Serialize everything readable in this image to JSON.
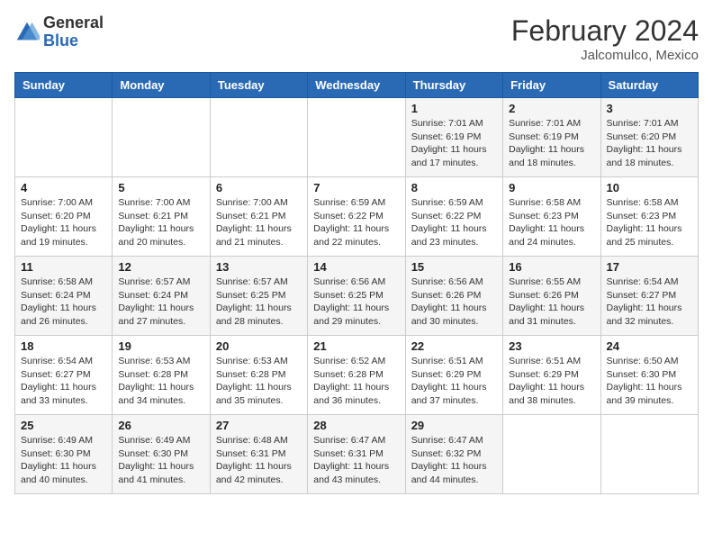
{
  "header": {
    "logo_general": "General",
    "logo_blue": "Blue",
    "month_title": "February 2024",
    "location": "Jalcomulco, Mexico"
  },
  "weekdays": [
    "Sunday",
    "Monday",
    "Tuesday",
    "Wednesday",
    "Thursday",
    "Friday",
    "Saturday"
  ],
  "weeks": [
    [
      {
        "day": "",
        "info": ""
      },
      {
        "day": "",
        "info": ""
      },
      {
        "day": "",
        "info": ""
      },
      {
        "day": "",
        "info": ""
      },
      {
        "day": "1",
        "info": "Sunrise: 7:01 AM\nSunset: 6:19 PM\nDaylight: 11 hours and 17 minutes."
      },
      {
        "day": "2",
        "info": "Sunrise: 7:01 AM\nSunset: 6:19 PM\nDaylight: 11 hours and 18 minutes."
      },
      {
        "day": "3",
        "info": "Sunrise: 7:01 AM\nSunset: 6:20 PM\nDaylight: 11 hours and 18 minutes."
      }
    ],
    [
      {
        "day": "4",
        "info": "Sunrise: 7:00 AM\nSunset: 6:20 PM\nDaylight: 11 hours and 19 minutes."
      },
      {
        "day": "5",
        "info": "Sunrise: 7:00 AM\nSunset: 6:21 PM\nDaylight: 11 hours and 20 minutes."
      },
      {
        "day": "6",
        "info": "Sunrise: 7:00 AM\nSunset: 6:21 PM\nDaylight: 11 hours and 21 minutes."
      },
      {
        "day": "7",
        "info": "Sunrise: 6:59 AM\nSunset: 6:22 PM\nDaylight: 11 hours and 22 minutes."
      },
      {
        "day": "8",
        "info": "Sunrise: 6:59 AM\nSunset: 6:22 PM\nDaylight: 11 hours and 23 minutes."
      },
      {
        "day": "9",
        "info": "Sunrise: 6:58 AM\nSunset: 6:23 PM\nDaylight: 11 hours and 24 minutes."
      },
      {
        "day": "10",
        "info": "Sunrise: 6:58 AM\nSunset: 6:23 PM\nDaylight: 11 hours and 25 minutes."
      }
    ],
    [
      {
        "day": "11",
        "info": "Sunrise: 6:58 AM\nSunset: 6:24 PM\nDaylight: 11 hours and 26 minutes."
      },
      {
        "day": "12",
        "info": "Sunrise: 6:57 AM\nSunset: 6:24 PM\nDaylight: 11 hours and 27 minutes."
      },
      {
        "day": "13",
        "info": "Sunrise: 6:57 AM\nSunset: 6:25 PM\nDaylight: 11 hours and 28 minutes."
      },
      {
        "day": "14",
        "info": "Sunrise: 6:56 AM\nSunset: 6:25 PM\nDaylight: 11 hours and 29 minutes."
      },
      {
        "day": "15",
        "info": "Sunrise: 6:56 AM\nSunset: 6:26 PM\nDaylight: 11 hours and 30 minutes."
      },
      {
        "day": "16",
        "info": "Sunrise: 6:55 AM\nSunset: 6:26 PM\nDaylight: 11 hours and 31 minutes."
      },
      {
        "day": "17",
        "info": "Sunrise: 6:54 AM\nSunset: 6:27 PM\nDaylight: 11 hours and 32 minutes."
      }
    ],
    [
      {
        "day": "18",
        "info": "Sunrise: 6:54 AM\nSunset: 6:27 PM\nDaylight: 11 hours and 33 minutes."
      },
      {
        "day": "19",
        "info": "Sunrise: 6:53 AM\nSunset: 6:28 PM\nDaylight: 11 hours and 34 minutes."
      },
      {
        "day": "20",
        "info": "Sunrise: 6:53 AM\nSunset: 6:28 PM\nDaylight: 11 hours and 35 minutes."
      },
      {
        "day": "21",
        "info": "Sunrise: 6:52 AM\nSunset: 6:28 PM\nDaylight: 11 hours and 36 minutes."
      },
      {
        "day": "22",
        "info": "Sunrise: 6:51 AM\nSunset: 6:29 PM\nDaylight: 11 hours and 37 minutes."
      },
      {
        "day": "23",
        "info": "Sunrise: 6:51 AM\nSunset: 6:29 PM\nDaylight: 11 hours and 38 minutes."
      },
      {
        "day": "24",
        "info": "Sunrise: 6:50 AM\nSunset: 6:30 PM\nDaylight: 11 hours and 39 minutes."
      }
    ],
    [
      {
        "day": "25",
        "info": "Sunrise: 6:49 AM\nSunset: 6:30 PM\nDaylight: 11 hours and 40 minutes."
      },
      {
        "day": "26",
        "info": "Sunrise: 6:49 AM\nSunset: 6:30 PM\nDaylight: 11 hours and 41 minutes."
      },
      {
        "day": "27",
        "info": "Sunrise: 6:48 AM\nSunset: 6:31 PM\nDaylight: 11 hours and 42 minutes."
      },
      {
        "day": "28",
        "info": "Sunrise: 6:47 AM\nSunset: 6:31 PM\nDaylight: 11 hours and 43 minutes."
      },
      {
        "day": "29",
        "info": "Sunrise: 6:47 AM\nSunset: 6:32 PM\nDaylight: 11 hours and 44 minutes."
      },
      {
        "day": "",
        "info": ""
      },
      {
        "day": "",
        "info": ""
      }
    ]
  ]
}
